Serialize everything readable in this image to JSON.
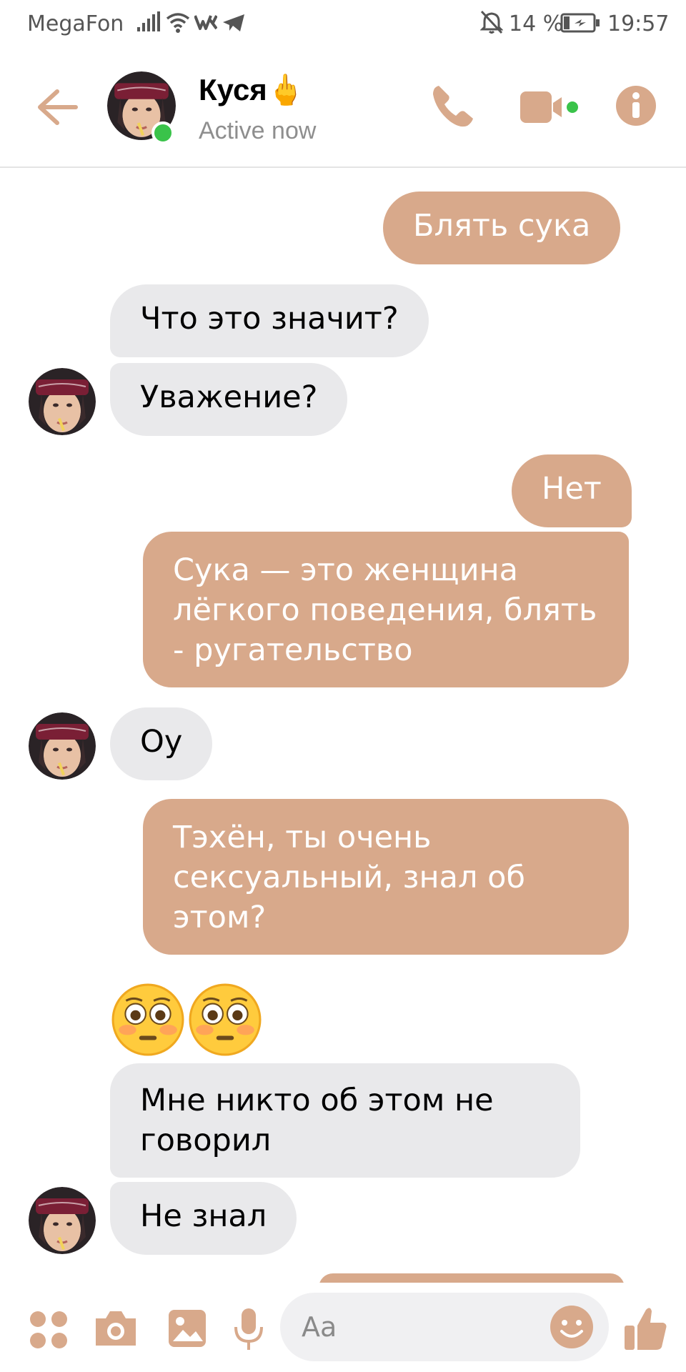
{
  "status_bar": {
    "carrier": "MegaFon",
    "battery": "14 %",
    "time": "19:57"
  },
  "header": {
    "contact_name": "Куся🖕",
    "status": "Active now"
  },
  "messages": [
    {
      "from": "me",
      "text": "Блять сука"
    },
    {
      "from": "contact",
      "text": "Что это значит?"
    },
    {
      "from": "contact",
      "text": "Уважение?"
    },
    {
      "from": "me",
      "text": "Нет"
    },
    {
      "from": "me",
      "text": "Сука — это женщина\nлёгкого поведения, блять\n- ругательство"
    },
    {
      "from": "contact",
      "text": "Оу"
    },
    {
      "from": "me",
      "text": "Тэхён, ты очень\nсексуальный, знал об\nэтом?"
    },
    {
      "from": "contact",
      "text": "😳😳"
    },
    {
      "from": "contact",
      "text": "Мне никто об этом не\nговорил"
    },
    {
      "from": "contact",
      "text": "Не знал"
    }
  ],
  "composer": {
    "placeholder": "Aa"
  },
  "colors": {
    "accent": "#d8a98b",
    "incoming_bubble": "#e9e9eb",
    "online": "#3ac34a"
  },
  "icons": [
    "back-arrow-icon",
    "phone-icon",
    "video-camera-icon",
    "info-icon",
    "apps-icon",
    "camera-icon",
    "gallery-icon",
    "microphone-icon",
    "emoji-icon",
    "thumbs-up-icon"
  ]
}
